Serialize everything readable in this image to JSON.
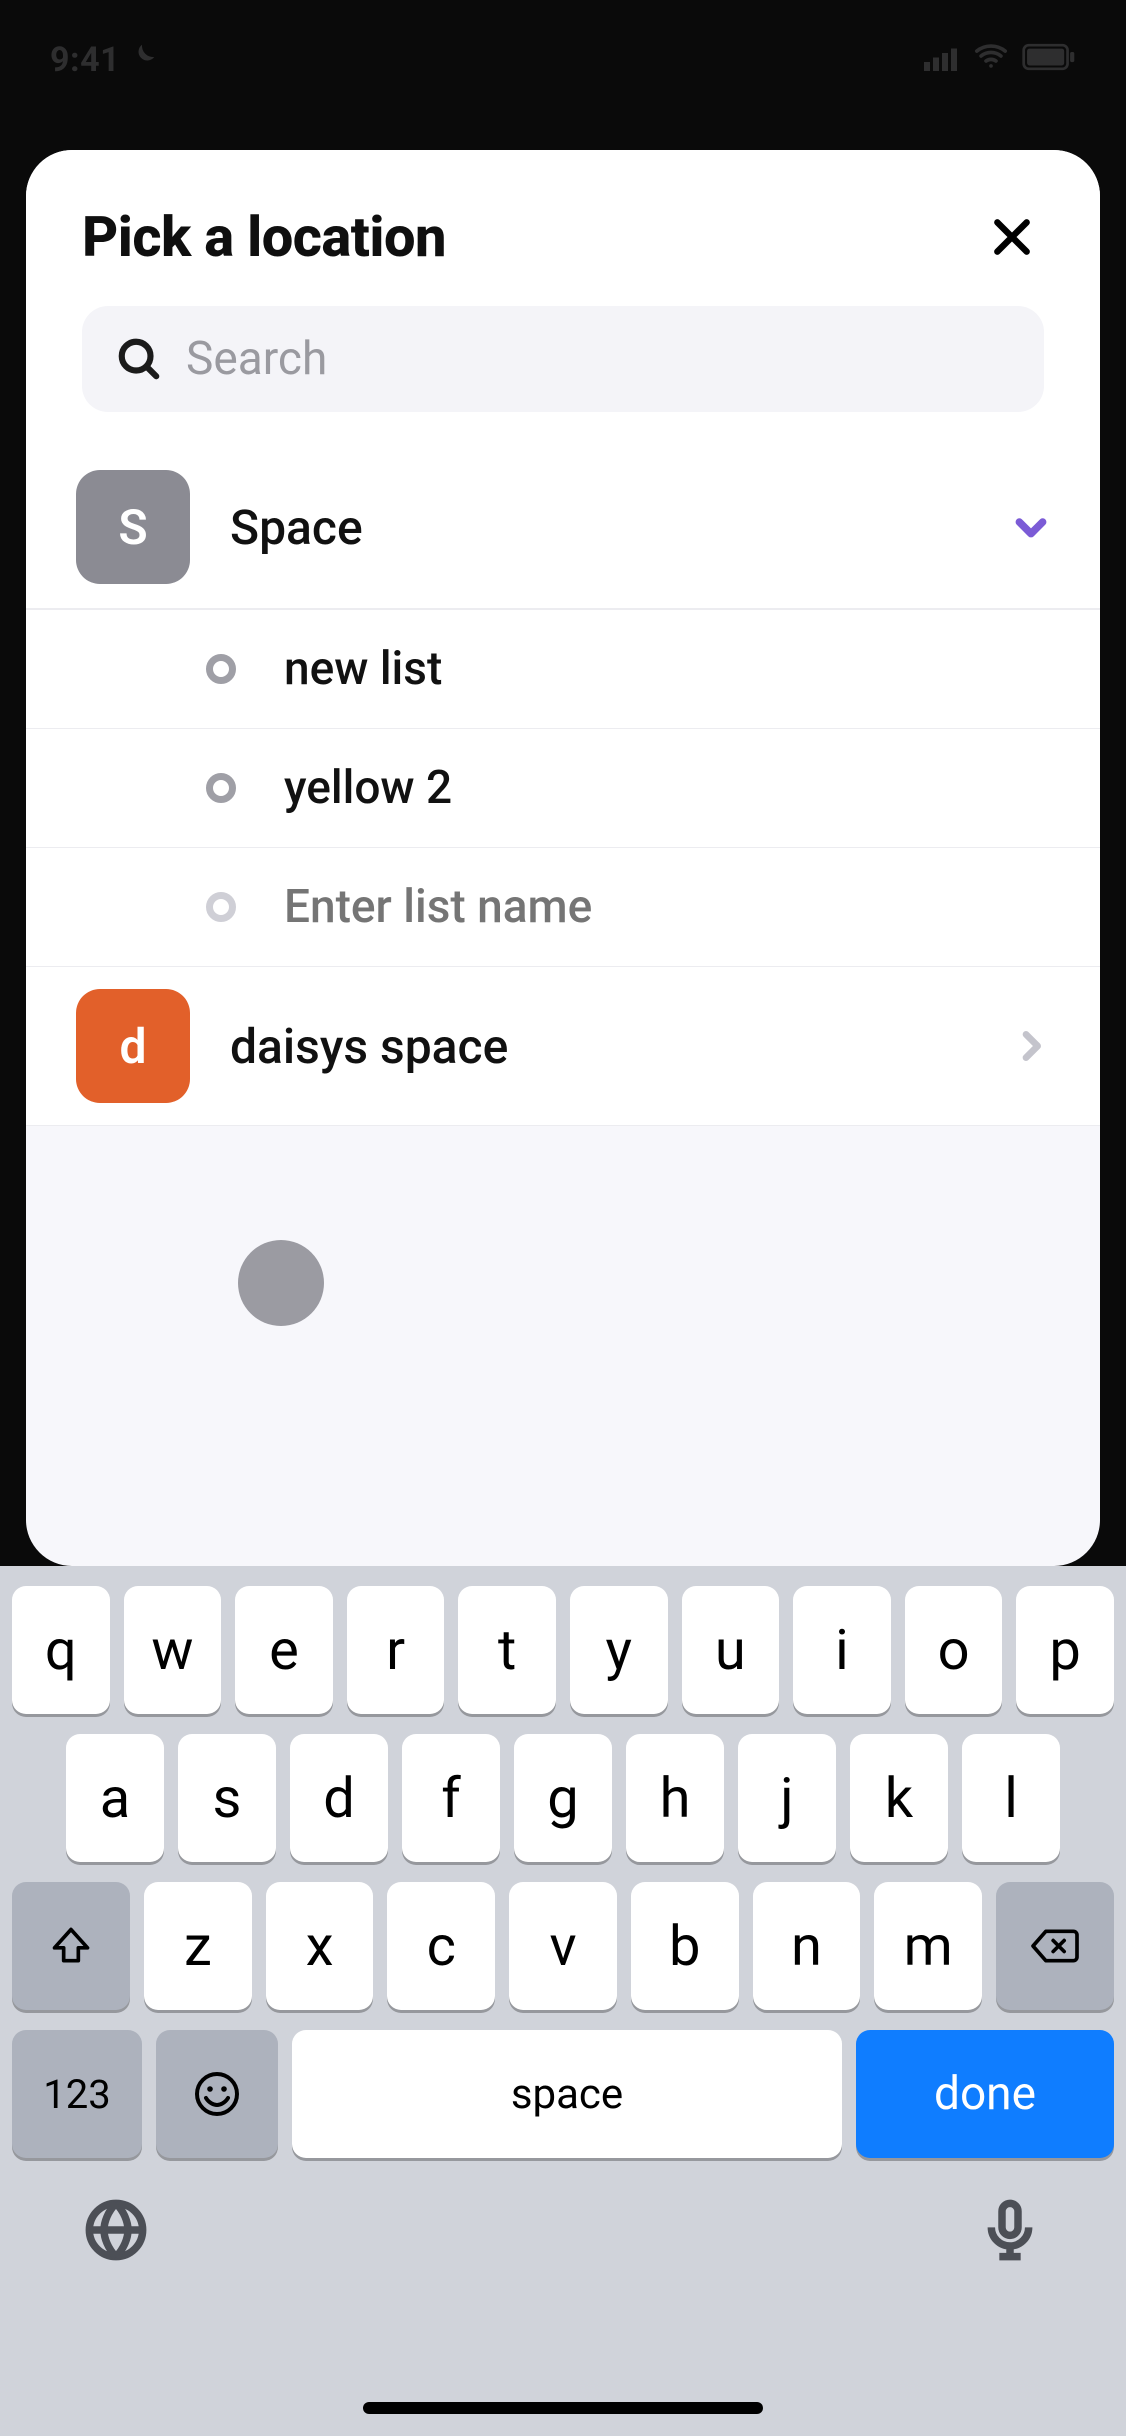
{
  "status": {
    "time": "9:41"
  },
  "sheet": {
    "title": "Pick a location",
    "search": {
      "placeholder": "Search",
      "value": ""
    }
  },
  "spaces": [
    {
      "name": "Space",
      "avatar_letter": "S",
      "avatar_color": "gray",
      "expanded": true,
      "lists": [
        {
          "name": "new list"
        },
        {
          "name": "yellow 2"
        }
      ],
      "new_list_placeholder": "Enter list name",
      "new_list_value": ""
    },
    {
      "name": "daisys space",
      "avatar_letter": "d",
      "avatar_color": "orange",
      "expanded": false,
      "lists": []
    }
  ],
  "keyboard": {
    "rows": [
      [
        "q",
        "w",
        "e",
        "r",
        "t",
        "y",
        "u",
        "i",
        "o",
        "p"
      ],
      [
        "a",
        "s",
        "d",
        "f",
        "g",
        "h",
        "j",
        "k",
        "l"
      ],
      [
        "z",
        "x",
        "c",
        "v",
        "b",
        "n",
        "m"
      ]
    ],
    "numeric_label": "123",
    "space_label": "space",
    "action_label": "done"
  }
}
